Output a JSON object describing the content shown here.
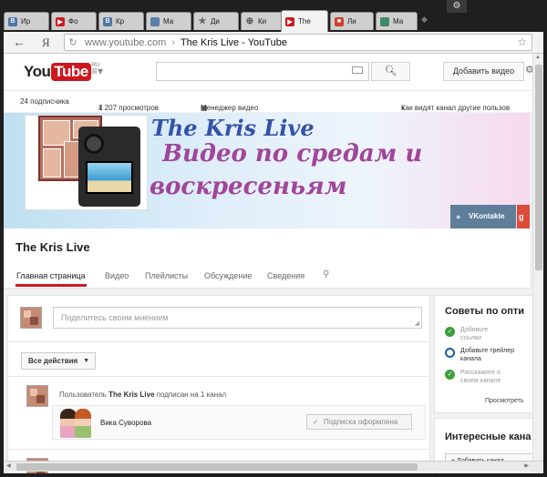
{
  "browser": {
    "tabs": [
      {
        "label": "Ир",
        "icon": "vk-icon",
        "color": "#4a76a8"
      },
      {
        "label": "Фо",
        "icon": "youtube-icon",
        "color": "#cc181e"
      },
      {
        "label": "Кр",
        "icon": "vk-icon",
        "color": "#4a76a8"
      },
      {
        "label": "Ма",
        "icon": "page-icon",
        "color": "#5a7fa8"
      },
      {
        "label": "Ди",
        "icon": "star-icon",
        "color": "#666666"
      },
      {
        "label": "Ки",
        "icon": "globe-icon",
        "color": "#555555"
      },
      {
        "label": "The",
        "icon": "youtube-icon",
        "color": "#cc181e"
      },
      {
        "label": "Ли",
        "icon": "gift-icon",
        "color": "#d0402b"
      },
      {
        "label": "Ма",
        "icon": "page-icon",
        "color": "#3f8a6a"
      }
    ],
    "menu_icon": "gear-icon",
    "back_icon": "back-arrow-icon",
    "yandex_logo": "Я",
    "address": {
      "host": "www.youtube.com",
      "separator": "›",
      "title": "The Kris Live - YouTube"
    }
  },
  "youtube": {
    "logo": {
      "you": "You",
      "tube": "Tube",
      "region": "RU"
    },
    "guide_icon": "≡▾",
    "search": {
      "placeholder": "",
      "button_icon": "search-icon"
    },
    "upload_label": "Добавить видео",
    "stats": {
      "subscribers": "24 подписчика",
      "views": "1 207 просмотров",
      "manager": "Менеджер видео",
      "viewer_mode": "Как видят канал другие пользов"
    },
    "banner": {
      "line1": "The Kris Live",
      "line2": "Видео по средам и",
      "line3": "воскресеньям",
      "links": [
        {
          "label": "VKontakte",
          "icon": "vk-icon"
        },
        {
          "label": "g",
          "icon": "google-plus-icon"
        }
      ]
    },
    "channel": {
      "name": "The Kris Live",
      "tabs": [
        "Главная страница",
        "Видео",
        "Плейлисты",
        "Обсуждение",
        "Сведения"
      ],
      "active_tab": "Главная страница"
    },
    "feed": {
      "share_placeholder": "Поделитесь своим мнением",
      "actions_label": "Все действия",
      "activity": {
        "prefix": "Пользователь",
        "user": "The Kris Live",
        "suffix": "подписан на 1 канал"
      },
      "subscribed_channel": "Вика Суворова",
      "subscribed_button": "Подписка оформлена"
    },
    "sidebar": {
      "tips_title": "Советы по опти",
      "tips": [
        {
          "text": "Добавьте ссылки",
          "done": true
        },
        {
          "text": "Добавьте трейлер канала",
          "done": false
        },
        {
          "text": "Расскажите о своем канале",
          "done": true
        }
      ],
      "view_more": "Просмотреть",
      "interesting_title": "Интересные кана",
      "add_channel": "+ Добавить канал"
    }
  }
}
